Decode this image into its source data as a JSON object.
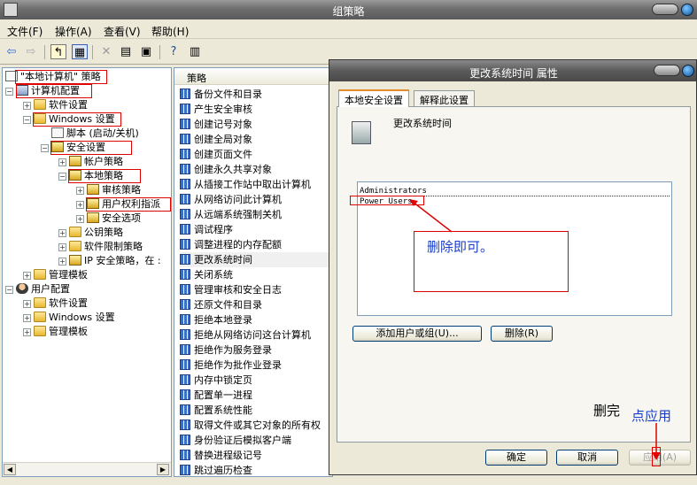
{
  "window_title": "组策略",
  "menu": [
    "文件(F)",
    "操作(A)",
    "查看(V)",
    "帮助(H)"
  ],
  "toolbar_icons": [
    "back-icon",
    "forward-icon",
    "up-folder-icon",
    "show-tree-icon",
    "delete-icon",
    "properties-icon",
    "export-icon",
    "help-icon",
    "view-icon"
  ],
  "tree": [
    {
      "label": "\"本地计算机\" 策略",
      "icon": "policy"
    },
    {
      "label": "计算机配置",
      "icon": "pc"
    },
    {
      "label": "软件设置",
      "icon": "folder"
    },
    {
      "label": "Windows 设置",
      "icon": "folder"
    },
    {
      "label": "脚本 (启动/关机)",
      "icon": "script"
    },
    {
      "label": "安全设置",
      "icon": "shield"
    },
    {
      "label": "帐户策略",
      "icon": "shield"
    },
    {
      "label": "本地策略",
      "icon": "shield"
    },
    {
      "label": "审核策略",
      "icon": "shield"
    },
    {
      "label": "用户权利指派",
      "icon": "shield"
    },
    {
      "label": "安全选项",
      "icon": "shield"
    },
    {
      "label": "公钥策略",
      "icon": "folder"
    },
    {
      "label": "软件限制策略",
      "icon": "folder"
    },
    {
      "label": "IP 安全策略，在 :",
      "icon": "shield"
    },
    {
      "label": "管理模板",
      "icon": "folder"
    },
    {
      "label": "用户配置",
      "icon": "user"
    },
    {
      "label": "软件设置",
      "icon": "folder"
    },
    {
      "label": "Windows 设置",
      "icon": "folder"
    },
    {
      "label": "管理模板",
      "icon": "folder"
    }
  ],
  "list": {
    "header": "策略",
    "items": [
      "备份文件和目录",
      "产生安全审核",
      "创建记号对象",
      "创建全局对象",
      "创建页面文件",
      "创建永久共享对象",
      "从插接工作站中取出计算机",
      "从网络访问此计算机",
      "从远端系统强制关机",
      "调试程序",
      "调整进程的内存配额",
      "更改系统时间",
      "关闭系统",
      "管理审核和安全日志",
      "还原文件和目录",
      "拒绝本地登录",
      "拒绝从网络访问这台计算机",
      "拒绝作为服务登录",
      "拒绝作为批作业登录",
      "内存中锁定页",
      "配置单一进程",
      "配置系统性能",
      "取得文件或其它对象的所有权",
      "身份验证后模拟客户端",
      "替换进程级记号",
      "跳过遍历检查"
    ]
  },
  "dialog": {
    "title": "更改系统时间 属性",
    "tabs": [
      "本地安全设置",
      "解释此设置"
    ],
    "policy_name": "更改系统时间",
    "users": [
      "Administrators",
      "Power Users"
    ],
    "add_button": "添加用户或组(U)...",
    "remove_button": "删除(R)",
    "ok_button": "确定",
    "cancel_button": "取消",
    "apply_button": "应用(A)"
  },
  "annotations": {
    "delete_note": "删除即可。",
    "done_note": "删完",
    "apply_note": "点应用"
  },
  "colors": {
    "annotation_red": "#e00000",
    "annotation_blue": "#1a3ec8"
  }
}
